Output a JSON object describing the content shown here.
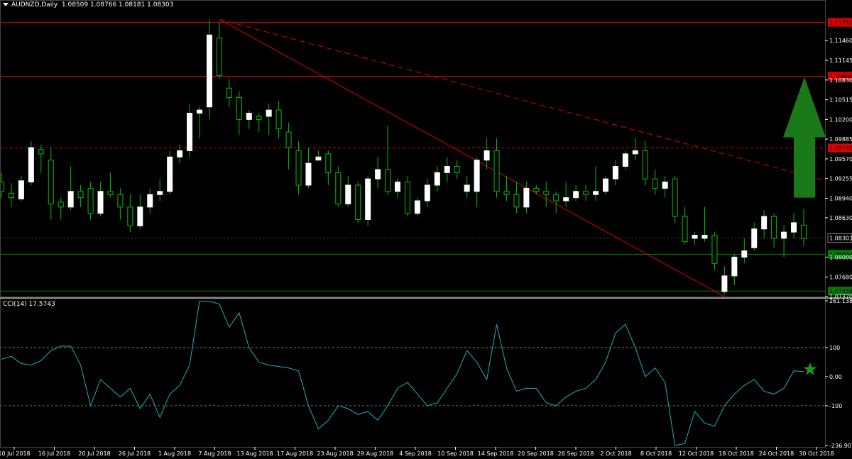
{
  "window": {
    "symbol_label": "AUDNZD,Daily",
    "ohlc": "1.08509 1.08766 1.08181 1.08303",
    "indicator_label": "CCI(14) 17.5743"
  },
  "colors": {
    "background": "#000000",
    "bull_candle": "#ffffff",
    "bear_candle": "#000000",
    "wick": "#00c000",
    "resistance": "#e00000",
    "support": "#008000",
    "cci_line": "#1fb0b8",
    "axis_text": "#ffffff",
    "arrow": "#1a7a1a"
  },
  "price_axis": {
    "ticks": [
      "1.11460",
      "1.11145",
      "1.10830",
      "1.10515",
      "1.10200",
      "1.09885",
      "1.09570",
      "1.09255",
      "1.08940",
      "1.08630",
      "1.08303",
      "1.08000",
      "1.07680",
      "1.07370"
    ],
    "current_price": "1.08303"
  },
  "levels": [
    {
      "label": "1.11751",
      "price": 1.11751,
      "style": "solid",
      "color": "#e00000"
    },
    {
      "label": "1.10890",
      "price": 1.1089,
      "style": "solid",
      "color": "#e00000"
    },
    {
      "label": "1.09745",
      "price": 1.09745,
      "style": "dashed",
      "color": "#e00000"
    },
    {
      "label": "1.08044",
      "price": 1.08044,
      "style": "solid",
      "color": "#008000"
    },
    {
      "label": "1.07458",
      "price": 1.07458,
      "style": "solid",
      "color": "#008000"
    }
  ],
  "cci_axis": {
    "ticks": [
      "261.1385",
      "100",
      "0.00",
      "-100",
      "-236.907"
    ],
    "values": [
      261.1385,
      100,
      0,
      -100,
      -236.907
    ]
  },
  "x_axis": {
    "dates": [
      "10 Jul 2018",
      "16 Jul 2018",
      "20 Jul 2018",
      "26 Jul 2018",
      "1 Aug 2018",
      "7 Aug 2018",
      "13 Aug 2018",
      "17 Aug 2018",
      "23 Aug 2018",
      "29 Aug 2018",
      "4 Sep 2018",
      "10 Sep 2018",
      "14 Sep 2018",
      "20 Sep 2018",
      "26 Sep 2018",
      "2 Oct 2018",
      "8 Oct 2018",
      "12 Oct 2018",
      "18 Oct 2018",
      "24 Oct 2018",
      "30 Oct 2018"
    ]
  },
  "chart_data": {
    "type": "candlestick",
    "symbol": "AUDNZD",
    "timeframe": "Daily",
    "ylim": [
      1.0737,
      1.1195
    ],
    "candles": [
      [
        1.092,
        1.0935,
        1.0895,
        1.0905
      ],
      [
        1.0902,
        1.0918,
        1.088,
        1.0895
      ],
      [
        1.0893,
        1.093,
        1.089,
        1.0922
      ],
      [
        1.092,
        1.0985,
        1.0915,
        1.0975
      ],
      [
        1.0972,
        1.098,
        1.0935,
        1.0965
      ],
      [
        1.0955,
        1.0975,
        1.086,
        1.0885
      ],
      [
        1.0888,
        1.0895,
        1.086,
        1.088
      ],
      [
        1.088,
        1.0945,
        1.0875,
        1.0905
      ],
      [
        1.0905,
        1.0915,
        1.088,
        1.0895
      ],
      [
        1.091,
        1.092,
        1.086,
        1.087
      ],
      [
        1.087,
        1.092,
        1.0865,
        1.0905
      ],
      [
        1.0905,
        1.0935,
        1.0895,
        1.09
      ],
      [
        1.09,
        1.091,
        1.086,
        1.088
      ],
      [
        1.088,
        1.09,
        1.084,
        1.085
      ],
      [
        1.085,
        1.09,
        1.0845,
        1.088
      ],
      [
        1.088,
        1.091,
        1.087,
        1.09
      ],
      [
        1.09,
        1.0925,
        1.089,
        1.0905
      ],
      [
        1.0905,
        1.097,
        1.09,
        1.096
      ],
      [
        1.096,
        1.098,
        1.095,
        1.097
      ],
      [
        1.097,
        1.1045,
        1.096,
        1.103
      ],
      [
        1.103,
        1.104,
        1.099,
        1.1035
      ],
      [
        1.104,
        1.118,
        1.102,
        1.1155
      ],
      [
        1.115,
        1.1175,
        1.1085,
        1.109
      ],
      [
        1.107,
        1.1085,
        1.104,
        1.1055
      ],
      [
        1.1055,
        1.1065,
        1.0995,
        1.102
      ],
      [
        1.102,
        1.1035,
        1.1005,
        1.103
      ],
      [
        1.1025,
        1.103,
        1.1,
        1.102
      ],
      [
        1.1025,
        1.1045,
        1.0995,
        1.1035
      ],
      [
        1.1035,
        1.105,
        1.099,
        1.1005
      ],
      [
        1.1,
        1.1015,
        1.094,
        1.0975
      ],
      [
        1.097,
        1.0985,
        1.09,
        1.0915
      ],
      [
        1.0915,
        1.0975,
        1.091,
        1.095
      ],
      [
        1.0955,
        1.097,
        1.0955,
        1.096
      ],
      [
        1.0965,
        1.097,
        1.0915,
        1.0935
      ],
      [
        1.0935,
        1.0945,
        1.088,
        1.0885
      ],
      [
        1.0885,
        1.093,
        1.088,
        1.0915
      ],
      [
        1.0915,
        1.092,
        1.0855,
        1.086
      ],
      [
        1.086,
        1.093,
        1.085,
        1.0925
      ],
      [
        1.0925,
        1.096,
        1.091,
        1.094
      ],
      [
        1.094,
        1.101,
        1.09,
        1.0905
      ],
      [
        1.0905,
        1.0925,
        1.0895,
        1.092
      ],
      [
        1.092,
        1.093,
        1.0865,
        1.087
      ],
      [
        1.087,
        1.0895,
        1.0865,
        1.089
      ],
      [
        1.089,
        1.0925,
        1.088,
        1.0915
      ],
      [
        1.0915,
        1.0945,
        1.0905,
        1.0935
      ],
      [
        1.0935,
        1.096,
        1.092,
        1.0945
      ],
      [
        1.0945,
        1.0955,
        1.0925,
        1.0935
      ],
      [
        1.0905,
        1.093,
        1.0895,
        1.0915
      ],
      [
        1.0905,
        1.096,
        1.088,
        1.0955
      ],
      [
        1.0955,
        1.099,
        1.094,
        1.097
      ],
      [
        1.097,
        1.099,
        1.0895,
        1.0905
      ],
      [
        1.0905,
        1.093,
        1.089,
        1.09
      ],
      [
        1.09,
        1.092,
        1.087,
        1.088
      ],
      [
        1.088,
        1.092,
        1.087,
        1.091
      ],
      [
        1.091,
        1.0915,
        1.09,
        1.0905
      ],
      [
        1.0905,
        1.092,
        1.088,
        1.09
      ],
      [
        1.09,
        1.0905,
        1.087,
        1.089
      ],
      [
        1.089,
        1.092,
        1.088,
        1.0895
      ],
      [
        1.0895,
        1.0915,
        1.089,
        1.0905
      ],
      [
        1.0905,
        1.0915,
        1.089,
        1.09
      ],
      [
        1.09,
        1.0945,
        1.089,
        1.0905
      ],
      [
        1.0905,
        1.093,
        1.09,
        1.0925
      ],
      [
        1.0925,
        1.0955,
        1.0915,
        1.0945
      ],
      [
        1.0945,
        1.097,
        1.094,
        1.0965
      ],
      [
        1.0965,
        1.099,
        1.0955,
        1.097
      ],
      [
        1.097,
        1.0985,
        1.0915,
        1.0925
      ],
      [
        1.0925,
        1.094,
        1.09,
        1.091
      ],
      [
        1.091,
        1.093,
        1.0895,
        1.092
      ],
      [
        1.0925,
        1.093,
        1.0855,
        1.0865
      ],
      [
        1.0865,
        1.088,
        1.082,
        1.0825
      ],
      [
        1.083,
        1.084,
        1.082,
        1.0835
      ],
      [
        1.083,
        1.088,
        1.0825,
        1.0835
      ],
      [
        1.0835,
        1.084,
        1.078,
        1.079
      ],
      [
        1.0745,
        1.0785,
        1.074,
        1.077
      ],
      [
        1.077,
        1.0805,
        1.0755,
        1.08
      ],
      [
        1.08,
        1.083,
        1.079,
        1.081
      ],
      [
        1.0815,
        1.0855,
        1.081,
        1.0845
      ],
      [
        1.0845,
        1.0875,
        1.083,
        1.0865
      ],
      [
        1.0865,
        1.087,
        1.0815,
        1.083
      ],
      [
        1.083,
        1.085,
        1.08,
        1.084
      ],
      [
        1.084,
        1.087,
        1.083,
        1.0855
      ],
      [
        1.0851,
        1.0877,
        1.0818,
        1.083
      ]
    ],
    "cci": [
      60,
      70,
      45,
      40,
      55,
      90,
      105,
      105,
      40,
      -100,
      -10,
      -40,
      -70,
      -40,
      -110,
      -60,
      -140,
      -60,
      -30,
      40,
      260,
      260,
      250,
      170,
      220,
      100,
      50,
      40,
      35,
      30,
      20,
      -100,
      -180,
      -150,
      -100,
      -110,
      -130,
      -120,
      -150,
      -100,
      -40,
      -20,
      -60,
      -100,
      -90,
      -40,
      10,
      90,
      50,
      -10,
      180,
      30,
      -50,
      -40,
      -40,
      -90,
      -100,
      -70,
      -50,
      -40,
      -10,
      50,
      150,
      180,
      100,
      0,
      30,
      -20,
      -250,
      -230,
      -120,
      -160,
      -170,
      -100,
      -60,
      -30,
      -10,
      -50,
      -60,
      -40,
      20,
      17.5743
    ],
    "cci_ylim": [
      -236.907,
      261.1385
    ],
    "annotation": "green up arrow",
    "current_price": 1.08303
  }
}
